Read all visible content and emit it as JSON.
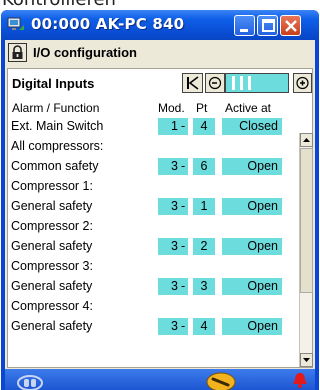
{
  "caption": "Kontrollieren",
  "window": {
    "title": "00:000 AK-PC 840"
  },
  "section": {
    "title": "I/O configuration"
  },
  "panel": {
    "title": "Digital Inputs",
    "columns": {
      "function": "Alarm / Function",
      "mod": "Mod.",
      "pt": "Pt",
      "active": "Active at"
    }
  },
  "rows": [
    {
      "label": "Ext. Main Switch",
      "mod": "1",
      "pt": "4",
      "active": "Closed"
    },
    {
      "label": "All compressors:"
    },
    {
      "label": "Common safety",
      "mod": "3",
      "pt": "6",
      "active": "Open"
    },
    {
      "label": "Compressor 1:"
    },
    {
      "label": "General safety",
      "mod": "3",
      "pt": "1",
      "active": "Open"
    },
    {
      "label": "Compressor 2:"
    },
    {
      "label": "General safety",
      "mod": "3",
      "pt": "2",
      "active": "Open"
    },
    {
      "label": "Compressor 3:"
    },
    {
      "label": "General safety",
      "mod": "3",
      "pt": "3",
      "active": "Open"
    },
    {
      "label": "Compressor 4:"
    },
    {
      "label": "General safety",
      "mod": "3",
      "pt": "4",
      "active": "Open"
    }
  ],
  "separator": "-",
  "icons": {
    "app": "pc-network-icon",
    "lock": "lock-icon",
    "nav_first": "first-page-icon",
    "nav_prev": "previous-page-icon",
    "nav_next": "next-page-icon",
    "status_left": "alarm-sensor-icon",
    "status_mid": "wrench-icon",
    "status_right": "alarm-bell-icon"
  },
  "colors": {
    "titlebar": "#0a4fd6",
    "cell_bg": "#6cdcdc",
    "client_bg": "#ece9d8",
    "close_button": "#c8401c",
    "alarm_red": "#e21a1a",
    "wrench_yellow": "#f2b31e"
  }
}
